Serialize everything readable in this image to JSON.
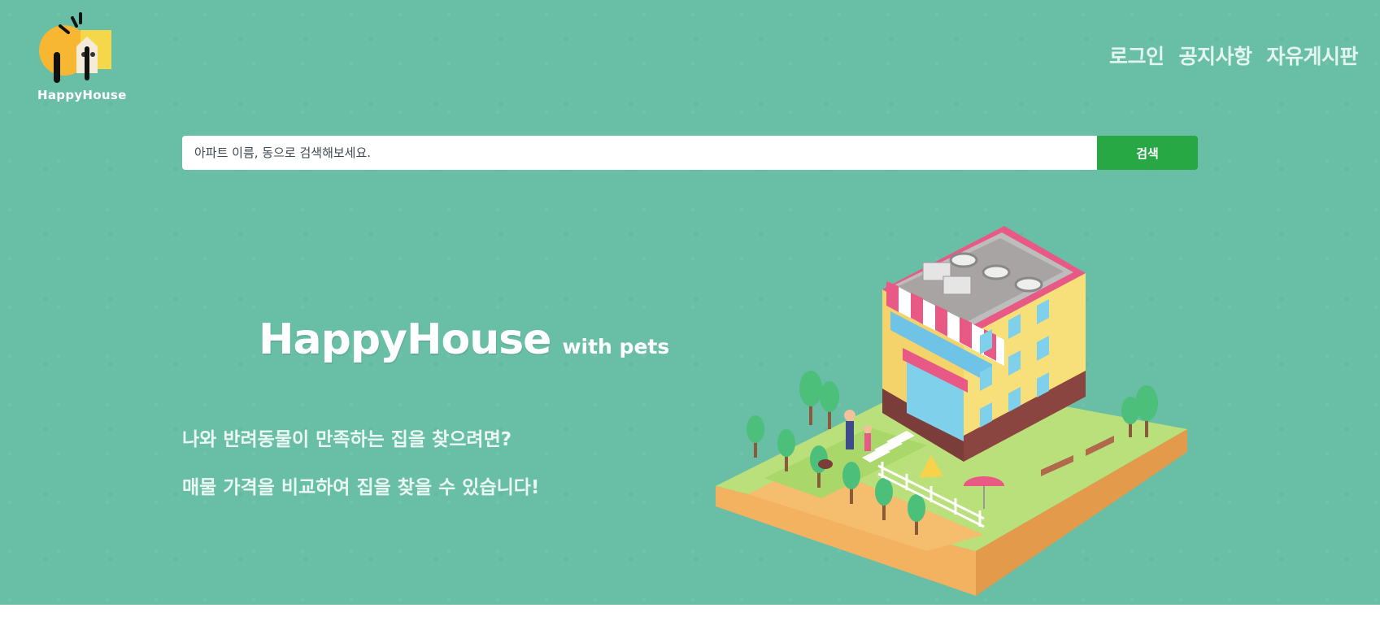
{
  "logo": {
    "text": "HappyHouse",
    "icon": "happyhouse-logo-icon"
  },
  "nav": {
    "items": [
      "로그인",
      "공지사항",
      "자유게시판"
    ]
  },
  "search": {
    "placeholder": "아파트 이름, 동으로 검색해보세요.",
    "button_label": "검색"
  },
  "hero": {
    "title": "HappyHouse",
    "subtitle": "with pets",
    "line1": "나와 반려동물이 만족하는 집을 찾으려면?",
    "line2": "매물 가격을 비교하여 집을 찾을 수 있습니다!",
    "illustration_icon": "isometric-house-icon"
  },
  "colors": {
    "hero_background": "#69bea6",
    "search_button": "#28a745",
    "text_light": "#ffffff"
  }
}
